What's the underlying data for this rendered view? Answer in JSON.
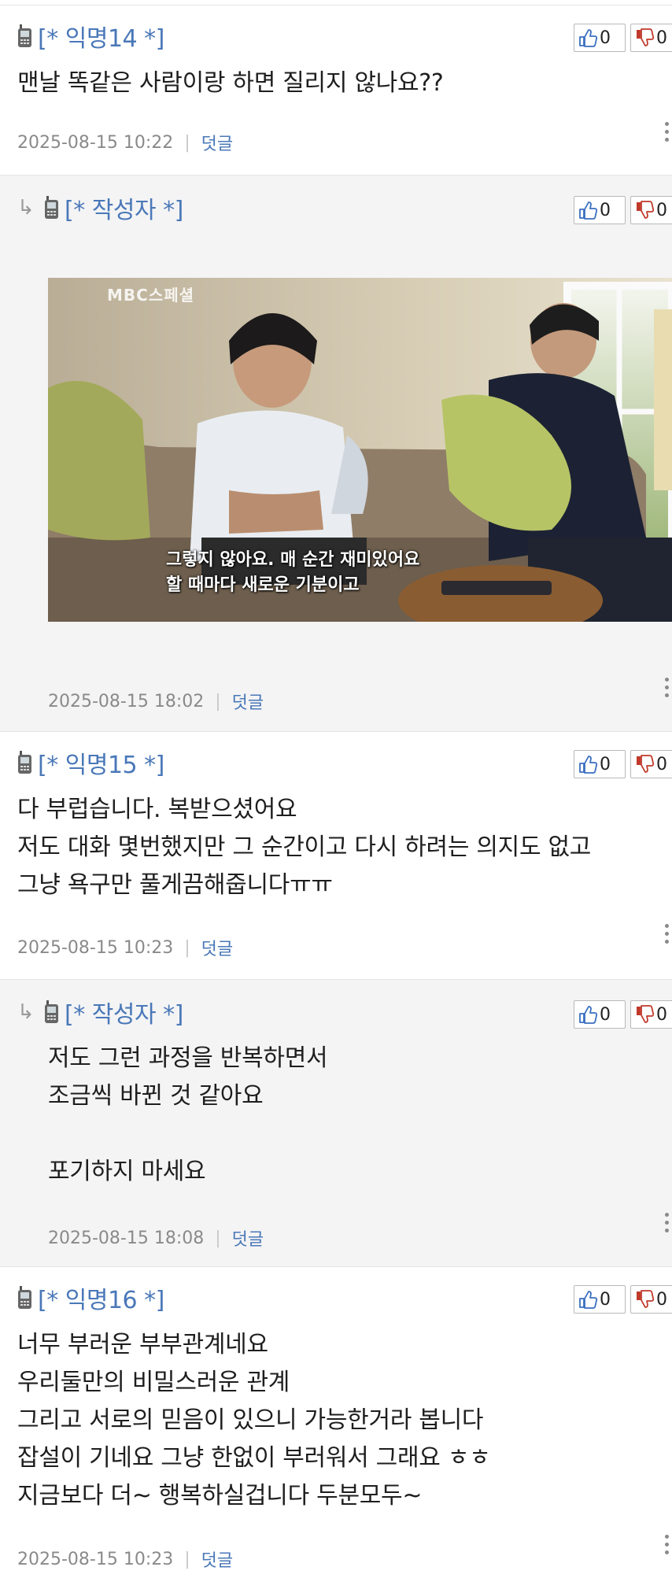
{
  "comments": [
    {
      "author": "[* 익명14 *]",
      "body": "맨날 똑같은 사람이랑 하면 질리지 않나요??",
      "timestamp": "2025-08-15 10:22",
      "reply_label": "덧글",
      "likes": "0",
      "dislikes": "0"
    },
    {
      "author": "[* 작성자 *]",
      "timestamp": "2025-08-15 18:02",
      "reply_label": "덧글",
      "likes": "0",
      "dislikes": "0",
      "image": {
        "watermark": "MBC스페셜",
        "caption_line1": "그렇지 않아요. 매 순간 재미있어요",
        "caption_line2": "할 때마다 새로운 기분이고"
      }
    },
    {
      "author": "[* 익명15 *]",
      "body": "다 부럽습니다. 복받으셨어요\n저도 대화 몇번했지만 그 순간이고 다시 하려는 의지도 없고\n그냥 욕구만 풀게끔해줍니다ㅠㅠ",
      "timestamp": "2025-08-15 10:23",
      "reply_label": "덧글",
      "likes": "0",
      "dislikes": "0"
    },
    {
      "author": "[* 작성자 *]",
      "body": "저도 그런 과정을 반복하면서\n조금씩 바뀐 것 같아요\n\n포기하지 마세요",
      "timestamp": "2025-08-15 18:08",
      "reply_label": "덧글",
      "likes": "0",
      "dislikes": "0"
    },
    {
      "author": "[* 익명16 *]",
      "body": "너무 부러운 부부관계네요\n우리둘만의 비밀스러운 관계\n그리고 서로의 믿음이 있으니 가능한거라 봅니다\n잡설이 기네요 그냥 한없이 부러워서 그래요 ㅎㅎ\n지금보다 더~ 행복하실겁니다 두분모두~",
      "timestamp": "2025-08-15 10:23",
      "reply_label": "덧글",
      "likes": "0",
      "dislikes": "0"
    }
  ],
  "icons": {
    "reply": "reply-arrow-icon",
    "device": "mobile-phone-icon",
    "like": "thumbs-up-icon",
    "dislike": "thumbs-down-icon",
    "more": "more-vertical-icon"
  },
  "colors": {
    "author": "#4a78b8",
    "link": "#4a78b8",
    "meta": "#8a8a8a",
    "reply_bg": "#f4f4f5"
  }
}
